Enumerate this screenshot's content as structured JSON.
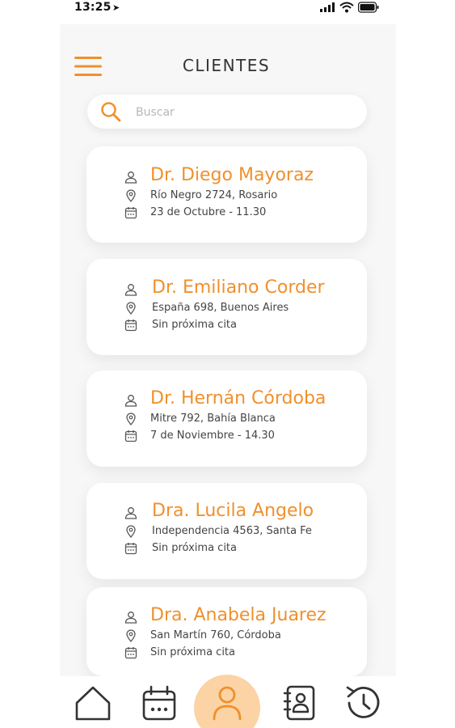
{
  "status_bar": {
    "time": "13:25"
  },
  "header": {
    "title": "CLIENTES"
  },
  "search": {
    "placeholder": "Buscar",
    "value": ""
  },
  "clients": [
    {
      "name": "Dr. Diego Mayoraz",
      "address": "Río Negro 2724, Rosario",
      "appointment": "23 de Octubre - 11.30"
    },
    {
      "name": "Dr. Emiliano Corder",
      "address": "España 698, Buenos Aires",
      "appointment": "Sin próxima cita"
    },
    {
      "name": "Dr. Hernán Córdoba",
      "address": "Mitre 792, Bahía Blanca",
      "appointment": "7 de Noviembre - 14.30"
    },
    {
      "name": "Dra. Lucila Angelo",
      "address": "Independencia 4563, Santa Fe",
      "appointment": "Sin próxima cita"
    },
    {
      "name": "Dra. Anabela Juarez",
      "address": "San Martín 760, Córdoba",
      "appointment": "Sin próxima cita"
    }
  ],
  "bottom_nav": {
    "items": [
      {
        "icon": "home-icon",
        "active": false
      },
      {
        "icon": "calendar-icon",
        "active": false
      },
      {
        "icon": "user-icon",
        "active": true
      },
      {
        "icon": "contacts-book-icon",
        "active": false
      },
      {
        "icon": "history-icon",
        "active": false
      }
    ]
  },
  "colors": {
    "accent": "#f0902c",
    "accent_light": "#fcd3a5",
    "text_dark": "#333333",
    "card_bg": "#ffffff",
    "page_bg": "#f7f7f7"
  }
}
